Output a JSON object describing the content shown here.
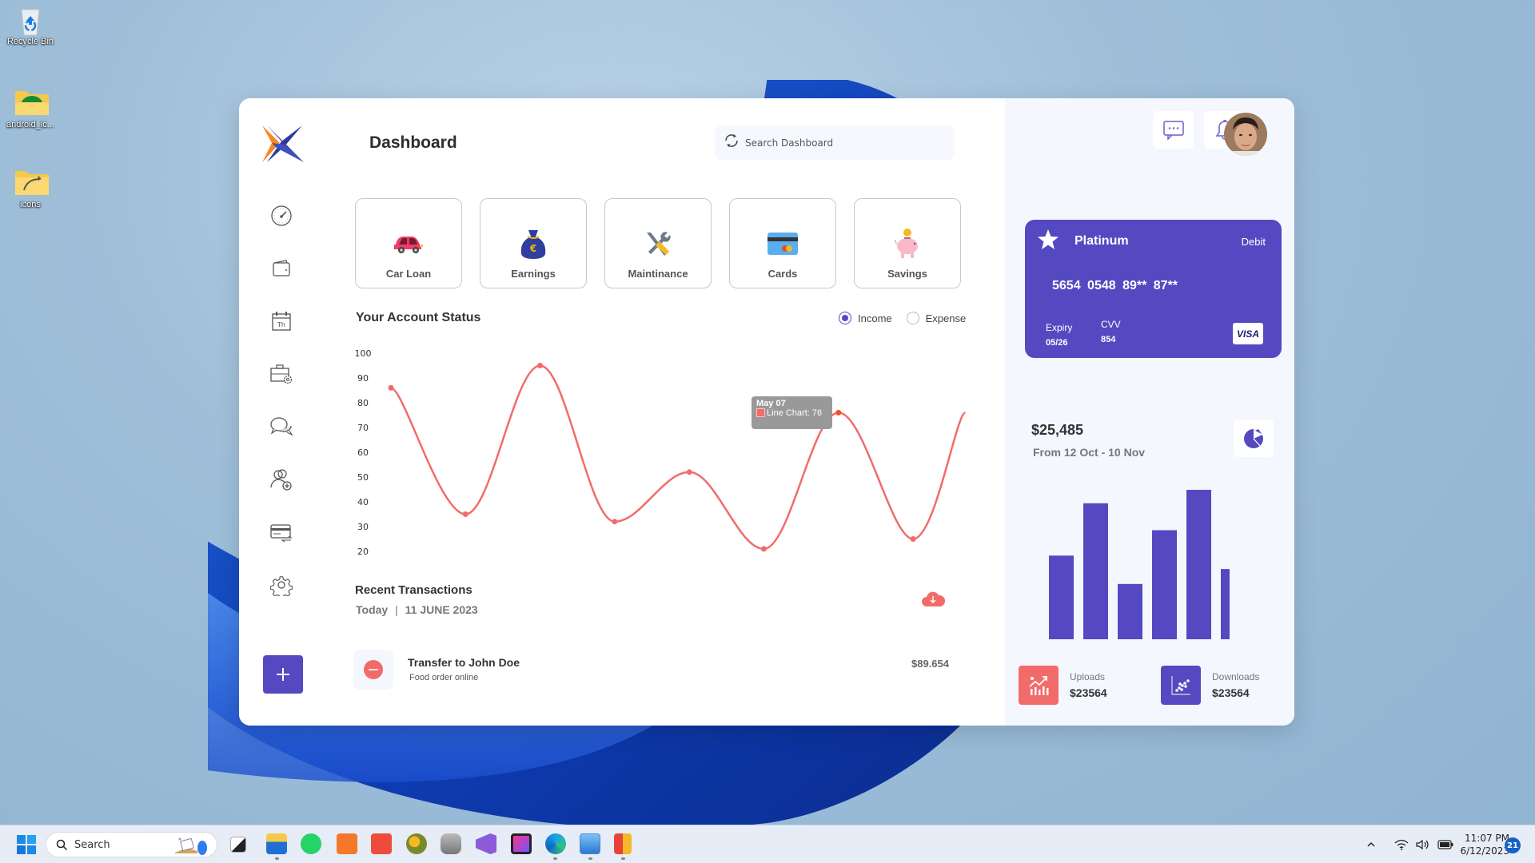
{
  "desktop": {
    "icons": [
      {
        "label": "Recycle Bin",
        "icon": "recycle-bin-icon"
      },
      {
        "label": "android_ic...",
        "icon": "folder-icon"
      },
      {
        "label": "icons",
        "icon": "folder-icon"
      }
    ]
  },
  "app": {
    "title": "Dashboard",
    "search": {
      "placeholder": "Search Dashboard",
      "value": ""
    },
    "nav": [
      {
        "name": "dashboard",
        "icon": "speedometer-icon"
      },
      {
        "name": "wallet",
        "icon": "wallet-icon"
      },
      {
        "name": "calendar",
        "icon": "calendar-icon",
        "label": "Th"
      },
      {
        "name": "briefcase-settings",
        "icon": "briefcase-gear-icon"
      },
      {
        "name": "messages",
        "icon": "chat-bubbles-icon"
      },
      {
        "name": "add-user",
        "icon": "user-add-icon"
      },
      {
        "name": "card-transfer",
        "icon": "card-transfer-icon"
      },
      {
        "name": "settings",
        "icon": "gear-icon"
      }
    ],
    "add_button": "+",
    "tiles": [
      {
        "label": "Car Loan",
        "icon": "car-icon"
      },
      {
        "label": "Earnings",
        "icon": "money-bag-icon"
      },
      {
        "label": "Maintinance",
        "icon": "tools-icon"
      },
      {
        "label": "Cards",
        "icon": "credit-card-icon"
      },
      {
        "label": "Savings",
        "icon": "piggy-bank-icon"
      }
    ],
    "account_status": {
      "title": "Your Account Status",
      "options": [
        {
          "label": "Income",
          "selected": true
        },
        {
          "label": "Expense",
          "selected": false
        }
      ]
    },
    "tooltip": {
      "title": "May 07",
      "series": "Line Chart",
      "value": 76
    },
    "transactions": {
      "title": "Recent Transactions",
      "today_label": "Today",
      "separator": "|",
      "date": "11 JUNE 2023",
      "items": [
        {
          "title": "Transfer to John Doe",
          "subtitle": "Food order online",
          "amount": "$89.654",
          "type": "debit"
        }
      ]
    }
  },
  "side": {
    "card": {
      "tier": "Platinum",
      "type": "Debit",
      "number": "5654 0548 89** 87**",
      "expiry_label": "Expiry",
      "expiry": "05/26",
      "cvv_label": "CVV",
      "cvv": "854",
      "network": "VISA"
    },
    "summary": {
      "total": "$25,485",
      "range": "From 12 Oct - 10 Nov"
    },
    "stats": [
      {
        "label": "Uploads",
        "value": "$23564",
        "color": "#f26b6b"
      },
      {
        "label": "Downloads",
        "value": "$23564",
        "color": "#5549c2"
      }
    ]
  },
  "colors": {
    "accent": "#5549c2",
    "line": "#f26b6b",
    "tooltip_bg": "#999999"
  },
  "chart_data": [
    {
      "type": "line",
      "title": "Your Account Status",
      "series": [
        {
          "name": "Line Chart",
          "values": [
            86,
            35,
            95,
            32,
            52,
            21,
            76,
            25,
            76
          ]
        }
      ],
      "highlighted_point": {
        "label": "May 07",
        "value": 76,
        "index": 6
      },
      "yticks": [
        100,
        90,
        80,
        70,
        60,
        50,
        40,
        30,
        20
      ],
      "ylim": [
        20,
        100
      ],
      "grid": false,
      "smooth": true,
      "last_point_partial": 0.7
    },
    {
      "type": "bar",
      "title": "$25,485",
      "subtitle": "From 12 Oct - 10 Nov",
      "values": [
        56,
        91,
        37,
        73,
        100,
        47
      ],
      "ylim": [
        0,
        100
      ],
      "axes": false,
      "last_bar_clipped": true
    }
  ],
  "taskbar": {
    "search_label": "Search",
    "apps": [
      "task-view",
      "file-explorer",
      "whatsapp",
      "xampp",
      "camtasia",
      "cyberduck",
      "database",
      "visual-studio",
      "phpstorm",
      "edge",
      "control-panel",
      "office-app"
    ],
    "time": "11:07 PM",
    "date": "6/12/2023",
    "notifications": "21"
  }
}
